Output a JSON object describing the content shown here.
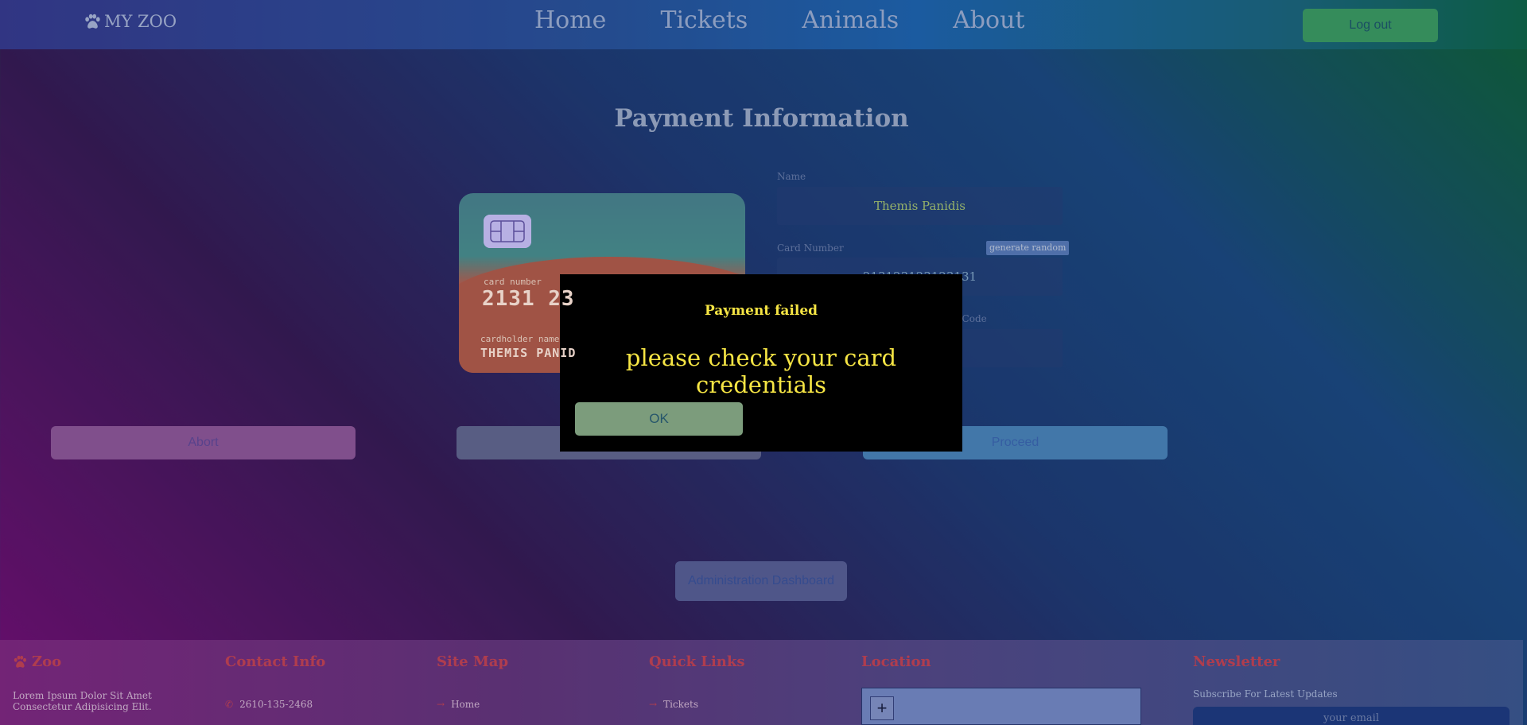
{
  "nav": {
    "brand": "MY ZOO",
    "links": [
      "Home",
      "Tickets",
      "Animals",
      "About"
    ],
    "logout": "Log out"
  },
  "page": {
    "title": "Payment Information"
  },
  "card": {
    "number_label": "card number",
    "number": "2131 23",
    "holder_label": "cardholder name",
    "holder": "THEMIS PANID"
  },
  "form": {
    "name_label": "Name",
    "name_value": "Themis Panidis",
    "card_number_label": "Card Number",
    "generate": "generate random",
    "card_number_value": "213123123123131",
    "code_label": "r Code",
    "code_value": "•••"
  },
  "actions": {
    "abort": "Abort",
    "middle": "",
    "proceed": "Proceed"
  },
  "admin": "Administration Dashboard",
  "footer": {
    "zoo_title": "Zoo",
    "zoo_text": "Lorem Ipsum Dolor Sit Amet Consectetur Adipisicing Elit.",
    "contact_title": "Contact Info",
    "phone": "2610-135-2468",
    "sitemap_title": "Site Map",
    "sitemap_item": "Home",
    "quicklinks_title": "Quick Links",
    "quicklinks_item": "Tickets",
    "location_title": "Location",
    "map_zoom": "+",
    "newsletter_title": "Newsletter",
    "newsletter_text": "Subscribe For Latest Updates",
    "newsletter_placeholder": "your email"
  },
  "modal": {
    "title": "Payment failed",
    "message": "please check your card credentials",
    "ok": "OK"
  }
}
